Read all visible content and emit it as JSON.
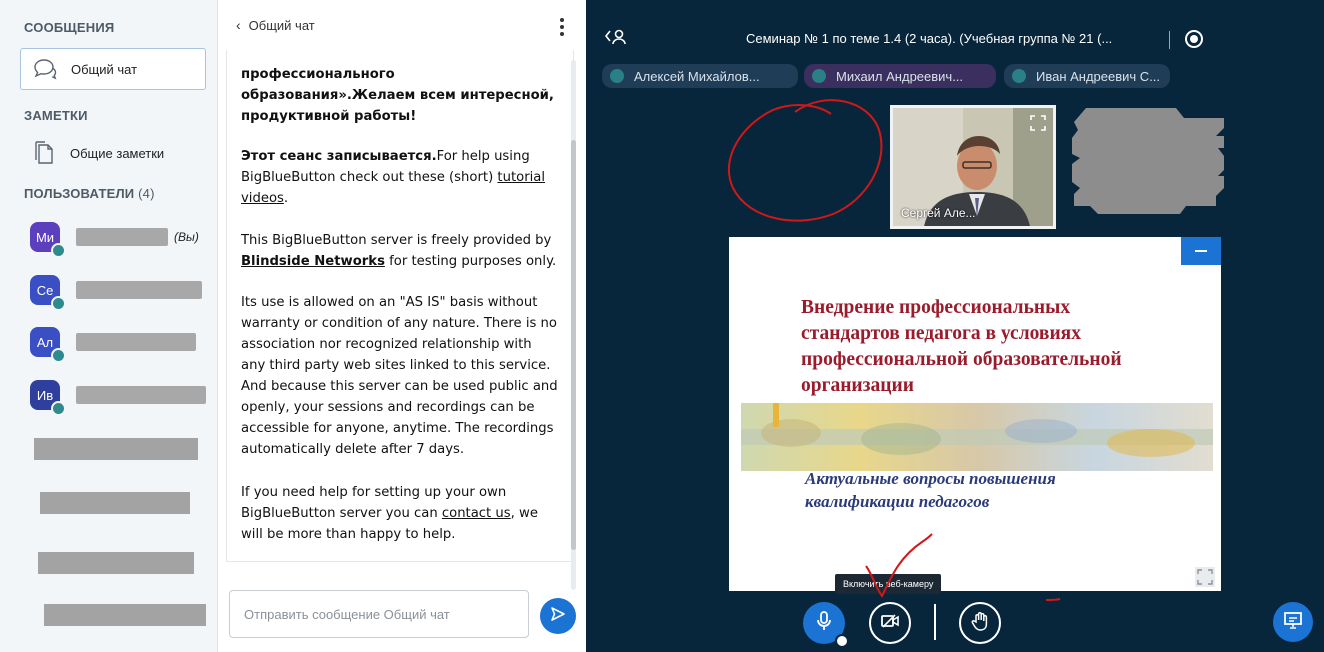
{
  "sidebar": {
    "messages_title": "СООБЩЕНИЯ",
    "public_chat": "Общий чат",
    "notes_title": "ЗАМЕТКИ",
    "shared_notes": "Общие заметки",
    "users_title": "ПОЛЬЗОВАТЕЛИ",
    "users_count": "(4)",
    "users": [
      {
        "initials": "Ми",
        "color": "#5b3fbd",
        "you": "(Вы)"
      },
      {
        "initials": "Се",
        "color": "#3a4fc4",
        "you": ""
      },
      {
        "initials": "Ал",
        "color": "#3a4fc4",
        "you": ""
      },
      {
        "initials": "Ив",
        "color": "#2f3f9e",
        "you": ""
      }
    ]
  },
  "chat": {
    "title": "Общий чат",
    "msg1_line1": "профессионального",
    "msg1_line2": "образования».Желаем всем интересной,",
    "msg1_line3": "продуктивной работы!",
    "msg2_bold": "Этот сеанс записывается.",
    "msg2_text": "For help using BigBlueButton check out these (short) ",
    "msg2_link": "tutorial videos",
    "msg2_end": ".",
    "msg3_text": "This BigBlueButton server is freely provided by ",
    "msg3_link": "Blindside Networks",
    "msg3_end": " for testing purposes only.",
    "msg4": "Its use is allowed on an \"AS IS\" basis without warranty or condition of any nature. There is no association nor recognized relationship with any third party web sites linked to this service. And because this server can be used public and openly, your sessions and recordings can be accessible for anyone, anytime. The recordings automatically delete after 7 days.",
    "msg5_text": "If you need help for setting up your own BigBlueButton server you can ",
    "msg5_link": "contact us",
    "msg5_end": ", we will be more than happy to help.",
    "input_placeholder": "Отправить сообщение Общий чат"
  },
  "presentation": {
    "session_title": "Семинар № 1 по теме 1.4 (2 часа). (Учебная группа № 21 (...",
    "talkers": [
      "Алексей Михайлов...",
      "Михаил Андреевич...",
      "Иван Андреевич С..."
    ],
    "webcam_name": "Сергей Але...",
    "slide_title": "Внедрение профессиональных стандартов педагога в условиях профессиональной образовательной организации",
    "slide_subtitle": "Актуальные вопросы повышения квалификации педагогов",
    "tooltip": "Включить веб-камеру"
  },
  "colors": {
    "accent": "#1b73d3",
    "main_bg": "#08263b",
    "slide_title": "#9a1b2b",
    "slide_subtitle": "#2a3b7a",
    "annotation": "#d01818"
  }
}
